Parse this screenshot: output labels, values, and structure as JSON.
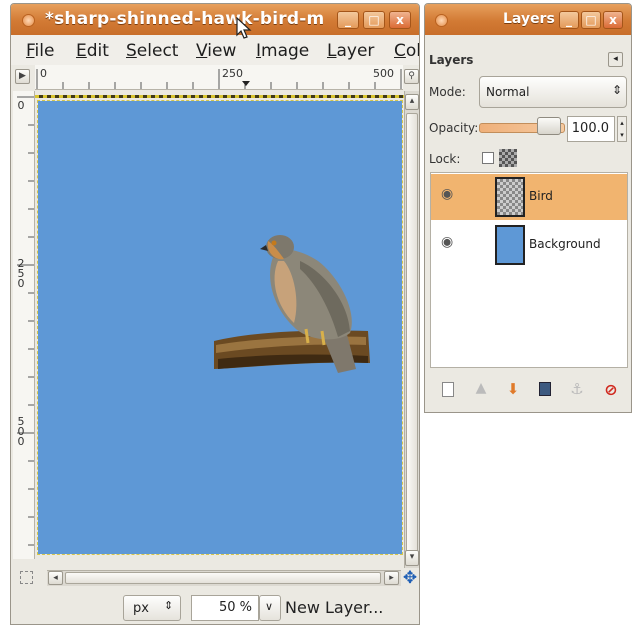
{
  "image_window": {
    "title": "*sharp-shinned-hawk-bird-m",
    "menu": [
      "File",
      "Edit",
      "Select",
      "View",
      "Image",
      "Layer",
      "Col"
    ],
    "ruler_h_labels": [
      "0",
      "250",
      "500"
    ],
    "ruler_v_labels": [
      "0",
      "250",
      "500"
    ],
    "status": {
      "unit": "px",
      "zoom": "50 %",
      "message": "New Layer..."
    }
  },
  "layers_window": {
    "title": "Layers",
    "panel_title": "Layers",
    "mode_label": "Mode:",
    "mode_value": "Normal",
    "opacity_label": "Opacity:",
    "opacity_value": "100.0",
    "opacity_level": 1.0,
    "lock_label": "Lock:",
    "layers": [
      {
        "name": "Bird",
        "selected": true,
        "visible": true
      },
      {
        "name": "Background",
        "selected": false,
        "visible": true
      }
    ]
  },
  "colors": {
    "titlebar": "#d27a34",
    "canvas_bg": "#5e98d6",
    "selected_layer": "#f1b46f"
  },
  "icons": {
    "close": "close-icon",
    "minimize": "minimize-icon",
    "maximize": "maximize-icon",
    "eye": "eye-icon",
    "navigate": "navigate-icon"
  }
}
